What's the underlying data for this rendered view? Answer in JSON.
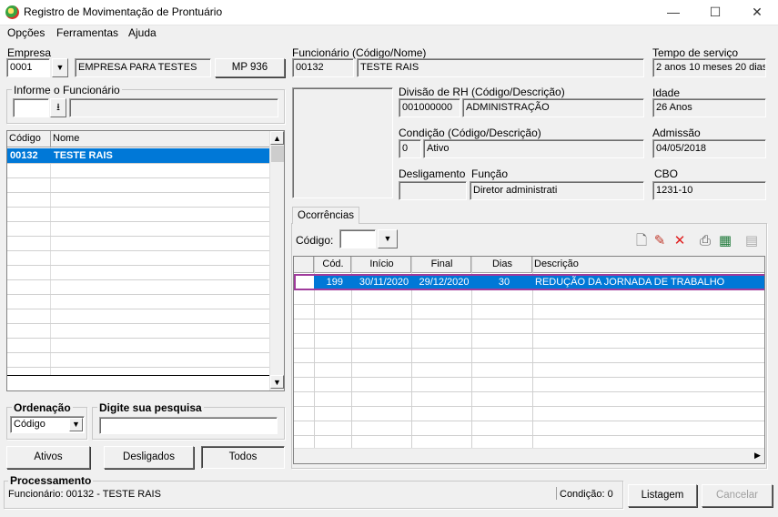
{
  "window": {
    "title": "Registro de Movimentação de Prontuário",
    "minimize": "—",
    "maximize": "☐",
    "close": "✕"
  },
  "menu": [
    "Opções",
    "Ferramentas",
    "Ajuda"
  ],
  "empresa": {
    "label": "Empresa",
    "code": "0001",
    "name": "EMPRESA PARA TESTES",
    "mp_button": "MP 936"
  },
  "funcionario": {
    "label": "Funcionário (Código/Nome)",
    "code": "00132",
    "name": "TESTE RAIS"
  },
  "tempo_servico": {
    "label": "Tempo de serviço",
    "value": "2 anos 10 meses 20 dias"
  },
  "informe": {
    "label": "Informe o Funcionário",
    "value": ""
  },
  "divisao": {
    "label": "Divisão de RH (Código/Descrição)",
    "code": "001000000",
    "desc": "ADMINISTRAÇÃO"
  },
  "idade": {
    "label": "Idade",
    "value": "26 Anos"
  },
  "condicao": {
    "label": "Condição (Código/Descrição)",
    "code": "0",
    "desc": "Ativo"
  },
  "admissao": {
    "label": "Admissão",
    "value": "04/05/2018"
  },
  "desligamento": {
    "label": "Desligamento",
    "value": ""
  },
  "funcao": {
    "label": "Função",
    "value": "Diretor administrati"
  },
  "cbo": {
    "label": "CBO",
    "value": "1231-10"
  },
  "emp_list": {
    "columns": [
      "Código",
      "Nome"
    ],
    "rows": [
      {
        "codigo": "00132",
        "nome": "TESTE RAIS"
      }
    ]
  },
  "ordenacao": {
    "label": "Ordenação",
    "value": "Código"
  },
  "pesquisa": {
    "label": "Digite sua pesquisa",
    "value": ""
  },
  "filters": {
    "ativos": "Ativos",
    "desligados": "Desligados",
    "todos": "Todos"
  },
  "ocorrencias": {
    "tab": "Ocorrências",
    "codigo_label": "Código:",
    "codigo_value": "",
    "columns": [
      "Cód.",
      "Início",
      "Final",
      "Dias",
      "Descrição"
    ],
    "rows": [
      {
        "cod": "199",
        "inicio": "30/11/2020",
        "final": "29/12/2020",
        "dias": "30",
        "descricao": "REDUÇÃO DA JORNADA DE TRABALHO"
      }
    ]
  },
  "processamento": {
    "label": "Processamento",
    "status": "Funcionário: 00132 - TESTE RAIS",
    "condicao": "Condição: 0"
  },
  "buttons": {
    "listagem": "Listagem",
    "cancelar": "Cancelar"
  }
}
